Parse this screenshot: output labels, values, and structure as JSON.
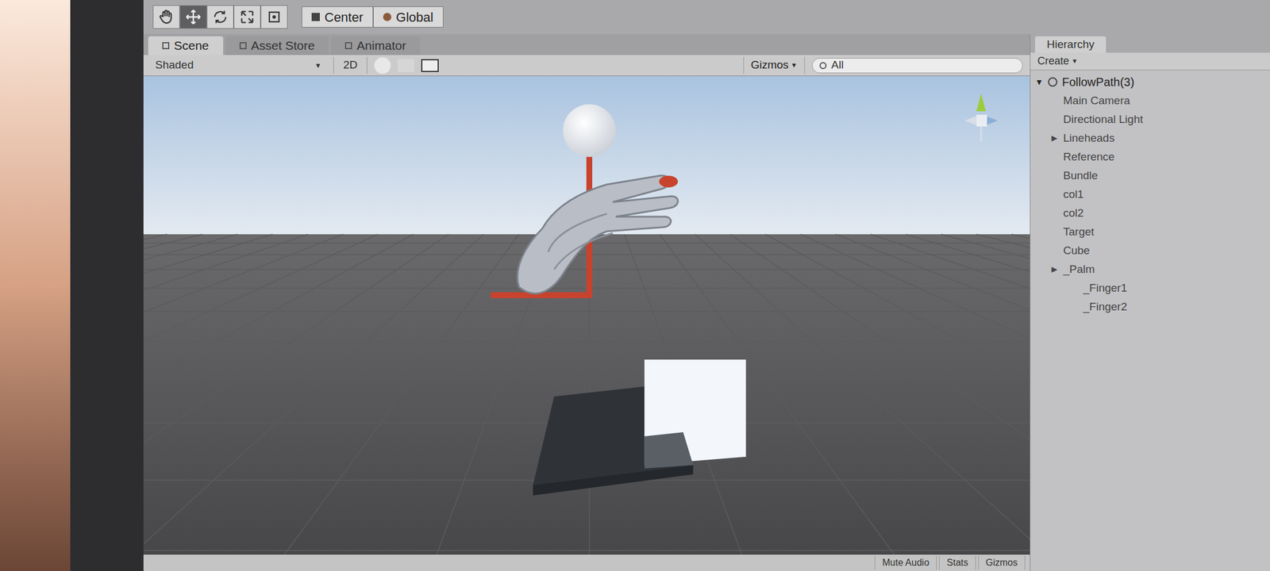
{
  "toolbar": {
    "pivot_buttons": [
      {
        "label": "Center"
      },
      {
        "label": "Global"
      }
    ]
  },
  "tabs": [
    {
      "label": "Scene",
      "selected": true
    },
    {
      "label": "Asset Store",
      "selected": false
    },
    {
      "label": "Animator",
      "selected": false
    }
  ],
  "scene_toolbar": {
    "shading": "Shaded",
    "mode_2d": "2D",
    "gizmos": "Gizmos",
    "search": "All"
  },
  "hierarchy": {
    "title": "Hierarchy",
    "create": "Create",
    "root": {
      "label": "FollowPath(3)",
      "expanded": true
    },
    "items": [
      {
        "label": "Main Camera",
        "expandable": false,
        "expanded": false,
        "depth": 1
      },
      {
        "label": "Directional Light",
        "expandable": false,
        "expanded": false,
        "depth": 1
      },
      {
        "label": "Lineheads",
        "expandable": true,
        "expanded": false,
        "depth": 1
      },
      {
        "label": "Reference",
        "expandable": false,
        "expanded": false,
        "depth": 1
      },
      {
        "label": "Bundle",
        "expandable": false,
        "expanded": false,
        "depth": 1
      },
      {
        "label": "col1",
        "expandable": false,
        "expanded": false,
        "depth": 1
      },
      {
        "label": "col2",
        "expandable": false,
        "expanded": false,
        "depth": 1
      },
      {
        "label": "Target",
        "expandable": false,
        "expanded": false,
        "depth": 1
      },
      {
        "label": "Cube",
        "expandable": false,
        "expanded": false,
        "depth": 1
      },
      {
        "label": "_Palm",
        "expandable": true,
        "expanded": false,
        "depth": 1
      },
      {
        "label": "_Finger1",
        "expandable": false,
        "expanded": false,
        "depth": 2
      },
      {
        "label": "_Finger2",
        "expandable": false,
        "expanded": false,
        "depth": 2
      }
    ]
  },
  "game_bar": {
    "buttons": [
      "Mute Audio",
      "Stats",
      "Gizmos"
    ]
  }
}
